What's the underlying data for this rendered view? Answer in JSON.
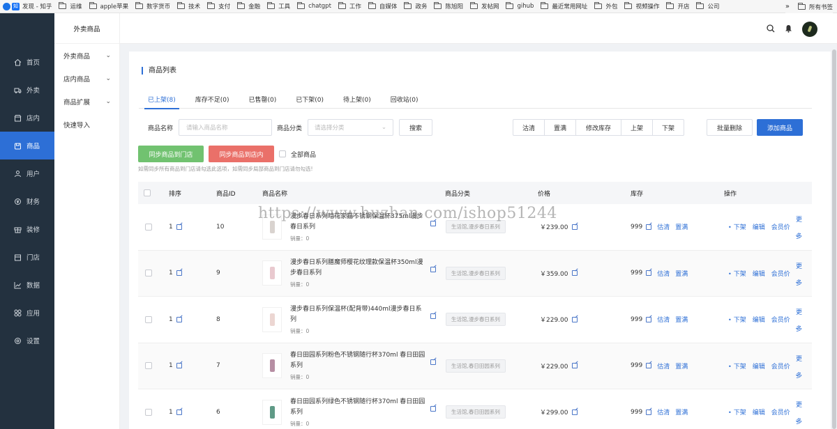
{
  "bookmarks": {
    "items": [
      {
        "label": "发现 - 知乎",
        "icon": "zhihu-icon"
      },
      {
        "label": "运维",
        "icon": "folder-icon"
      },
      {
        "label": "apple苹果",
        "icon": "folder-icon"
      },
      {
        "label": "数字货币",
        "icon": "folder-icon"
      },
      {
        "label": "技术",
        "icon": "folder-icon"
      },
      {
        "label": "支付",
        "icon": "folder-icon"
      },
      {
        "label": "金融",
        "icon": "folder-icon"
      },
      {
        "label": "工具",
        "icon": "folder-icon"
      },
      {
        "label": "chatgpt",
        "icon": "folder-icon"
      },
      {
        "label": "工作",
        "icon": "folder-icon"
      },
      {
        "label": "自媒体",
        "icon": "folder-icon"
      },
      {
        "label": "政务",
        "icon": "folder-icon"
      },
      {
        "label": "陈旭阳",
        "icon": "folder-icon"
      },
      {
        "label": "发帖网",
        "icon": "folder-icon"
      },
      {
        "label": "gihub",
        "icon": "folder-icon"
      },
      {
        "label": "最近常用网址",
        "icon": "folder-icon"
      },
      {
        "label": "外包",
        "icon": "folder-icon"
      },
      {
        "label": "视频操作",
        "icon": "folder-icon"
      },
      {
        "label": "开店",
        "icon": "folder-icon"
      },
      {
        "label": "公司",
        "icon": "folder-icon"
      }
    ],
    "overflow": "»",
    "all_bookmarks": "所有书签"
  },
  "sidebar": {
    "items": [
      {
        "label": "首页",
        "icon": "home-icon"
      },
      {
        "label": "外卖",
        "icon": "delivery-icon"
      },
      {
        "label": "店内",
        "icon": "store-icon"
      },
      {
        "label": "商品",
        "icon": "goods-icon",
        "active": true
      },
      {
        "label": "用户",
        "icon": "user-icon"
      },
      {
        "label": "财务",
        "icon": "finance-icon"
      },
      {
        "label": "装修",
        "icon": "decorate-icon"
      },
      {
        "label": "门店",
        "icon": "shop-icon"
      },
      {
        "label": "数据",
        "icon": "chart-icon"
      },
      {
        "label": "应用",
        "icon": "apps-icon"
      },
      {
        "label": "设置",
        "icon": "settings-icon"
      }
    ]
  },
  "subnav": {
    "title": "外卖商品",
    "items": [
      {
        "label": "外卖商品",
        "has_chevron": true
      },
      {
        "label": "店内商品",
        "has_chevron": true
      },
      {
        "label": "商品扩展",
        "has_chevron": true
      },
      {
        "label": "快速导入",
        "has_chevron": false
      }
    ]
  },
  "page": {
    "title": "商品列表",
    "tabs": [
      "已上架(8)",
      "库存不足(0)",
      "已售罄(0)",
      "已下架(0)",
      "待上架(0)",
      "回收站(0)"
    ],
    "active_tab": 0
  },
  "filters": {
    "name_label": "商品名称",
    "name_placeholder": "请输入商品名称",
    "category_label": "商品分类",
    "category_placeholder": "请选择分类",
    "search": "搜索"
  },
  "actions": {
    "group": [
      "沽清",
      "置满",
      "修改库存",
      "上架",
      "下架"
    ],
    "batch_delete": "批量删除",
    "add_goods": "添加商品"
  },
  "sync": {
    "to_store_front": "同步商品到门店",
    "to_store_in": "同步商品到店内",
    "all_goods": "全部商品",
    "hint": "如需同步所有商品到门店请勾选此选项，如需同步局部商品到门店请勿勾选!"
  },
  "table": {
    "headers": [
      "排序",
      "商品ID",
      "商品名称",
      "商品分类",
      "价格",
      "库存",
      "操作"
    ],
    "rows": [
      {
        "sort": "1",
        "id": "10",
        "name": "漫步春日系列暗花家猫不锈钢保温杯375ml漫步春日系列",
        "sales": "销量：0",
        "category": "生活馆,漫步春日系列",
        "price": "￥239.00",
        "stock": "999",
        "cup_color": "#d9d3cf"
      },
      {
        "sort": "1",
        "id": "9",
        "name": "漫步春日系列膳魔师樱花纹理款保温杯350ml漫步春日系列",
        "sales": "销量：0",
        "category": "生活馆,漫步春日系列",
        "price": "￥359.00",
        "stock": "999",
        "cup_color": "#e9c9cf"
      },
      {
        "sort": "1",
        "id": "8",
        "name": "漫步春日系列保温杯(配背带)440ml漫步春日系列",
        "sales": "销量：0",
        "category": "生活馆,漫步春日系列",
        "price": "￥229.00",
        "stock": "999",
        "cup_color": "#ecd6d2"
      },
      {
        "sort": "1",
        "id": "7",
        "name": "春日田园系列粉色不锈钢随行杯370ml 春日田园系列",
        "sales": "销量：0",
        "category": "生活馆,春日田园系列",
        "price": "￥229.00",
        "stock": "999",
        "cup_color": "#b68ea3"
      },
      {
        "sort": "1",
        "id": "6",
        "name": "春日田园系列绿色不锈钢随行杯370ml 春日田园系列",
        "sales": "销量：0",
        "category": "生活馆,春日田园系列",
        "price": "￥299.00",
        "stock": "999",
        "cup_color": "#5f9a86"
      }
    ],
    "row_actions": {
      "sold_out": "估清",
      "fill": "置满",
      "off_shelf": "下架",
      "edit": "编辑",
      "member_price": "会员价",
      "more": "更多"
    }
  },
  "watermark": "https://www.huzhan.com/ishop51244"
}
